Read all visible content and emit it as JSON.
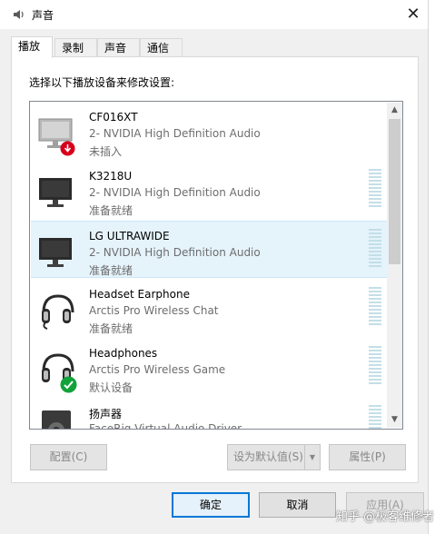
{
  "window": {
    "title": "声音",
    "close_glyph": "✕"
  },
  "tabs": [
    {
      "label": "播放",
      "active": true
    },
    {
      "label": "录制",
      "active": false
    },
    {
      "label": "声音",
      "active": false
    },
    {
      "label": "通信",
      "active": false
    }
  ],
  "instruction": "选择以下播放设备来修改设置:",
  "devices": [
    {
      "name": "CF016XT",
      "line2": "2- NVIDIA High Definition Audio",
      "status": "未插入",
      "icon": "monitor-icon",
      "badge": "unplugged-badge-icon",
      "meter": false,
      "selected": false
    },
    {
      "name": "K3218U",
      "line2": "2- NVIDIA High Definition Audio",
      "status": "准备就绪",
      "icon": "monitor-icon",
      "badge": "",
      "meter": true,
      "selected": false
    },
    {
      "name": "LG ULTRAWIDE",
      "line2": "2- NVIDIA High Definition Audio",
      "status": "准备就绪",
      "icon": "monitor-icon",
      "badge": "",
      "meter": true,
      "selected": true
    },
    {
      "name": "Headset Earphone",
      "line2": "Arctis Pro Wireless Chat",
      "status": "准备就绪",
      "icon": "headset-icon",
      "badge": "",
      "meter": true,
      "selected": false
    },
    {
      "name": "Headphones",
      "line2": "Arctis Pro Wireless Game",
      "status": "默认设备",
      "icon": "headset-icon",
      "badge": "default-check-icon",
      "meter": true,
      "selected": false
    },
    {
      "name": "扬声器",
      "line2": "FaceRig Virtual Audio Driver",
      "status": "",
      "icon": "speaker-icon",
      "badge": "",
      "meter": true,
      "selected": false
    }
  ],
  "buttons": {
    "configure": "配置(C)",
    "set_default": "设为默认值(S)",
    "properties": "属性(P)",
    "ok": "确定",
    "cancel": "取消",
    "apply": "应用(A)"
  },
  "watermark": "知乎 @极客维修者",
  "colors": {
    "accent": "#0078d7",
    "selected_row": "#e5f3fb",
    "meter": "#c3dfe8",
    "check_green": "#12a23a",
    "unplug_red": "#d6001c"
  }
}
